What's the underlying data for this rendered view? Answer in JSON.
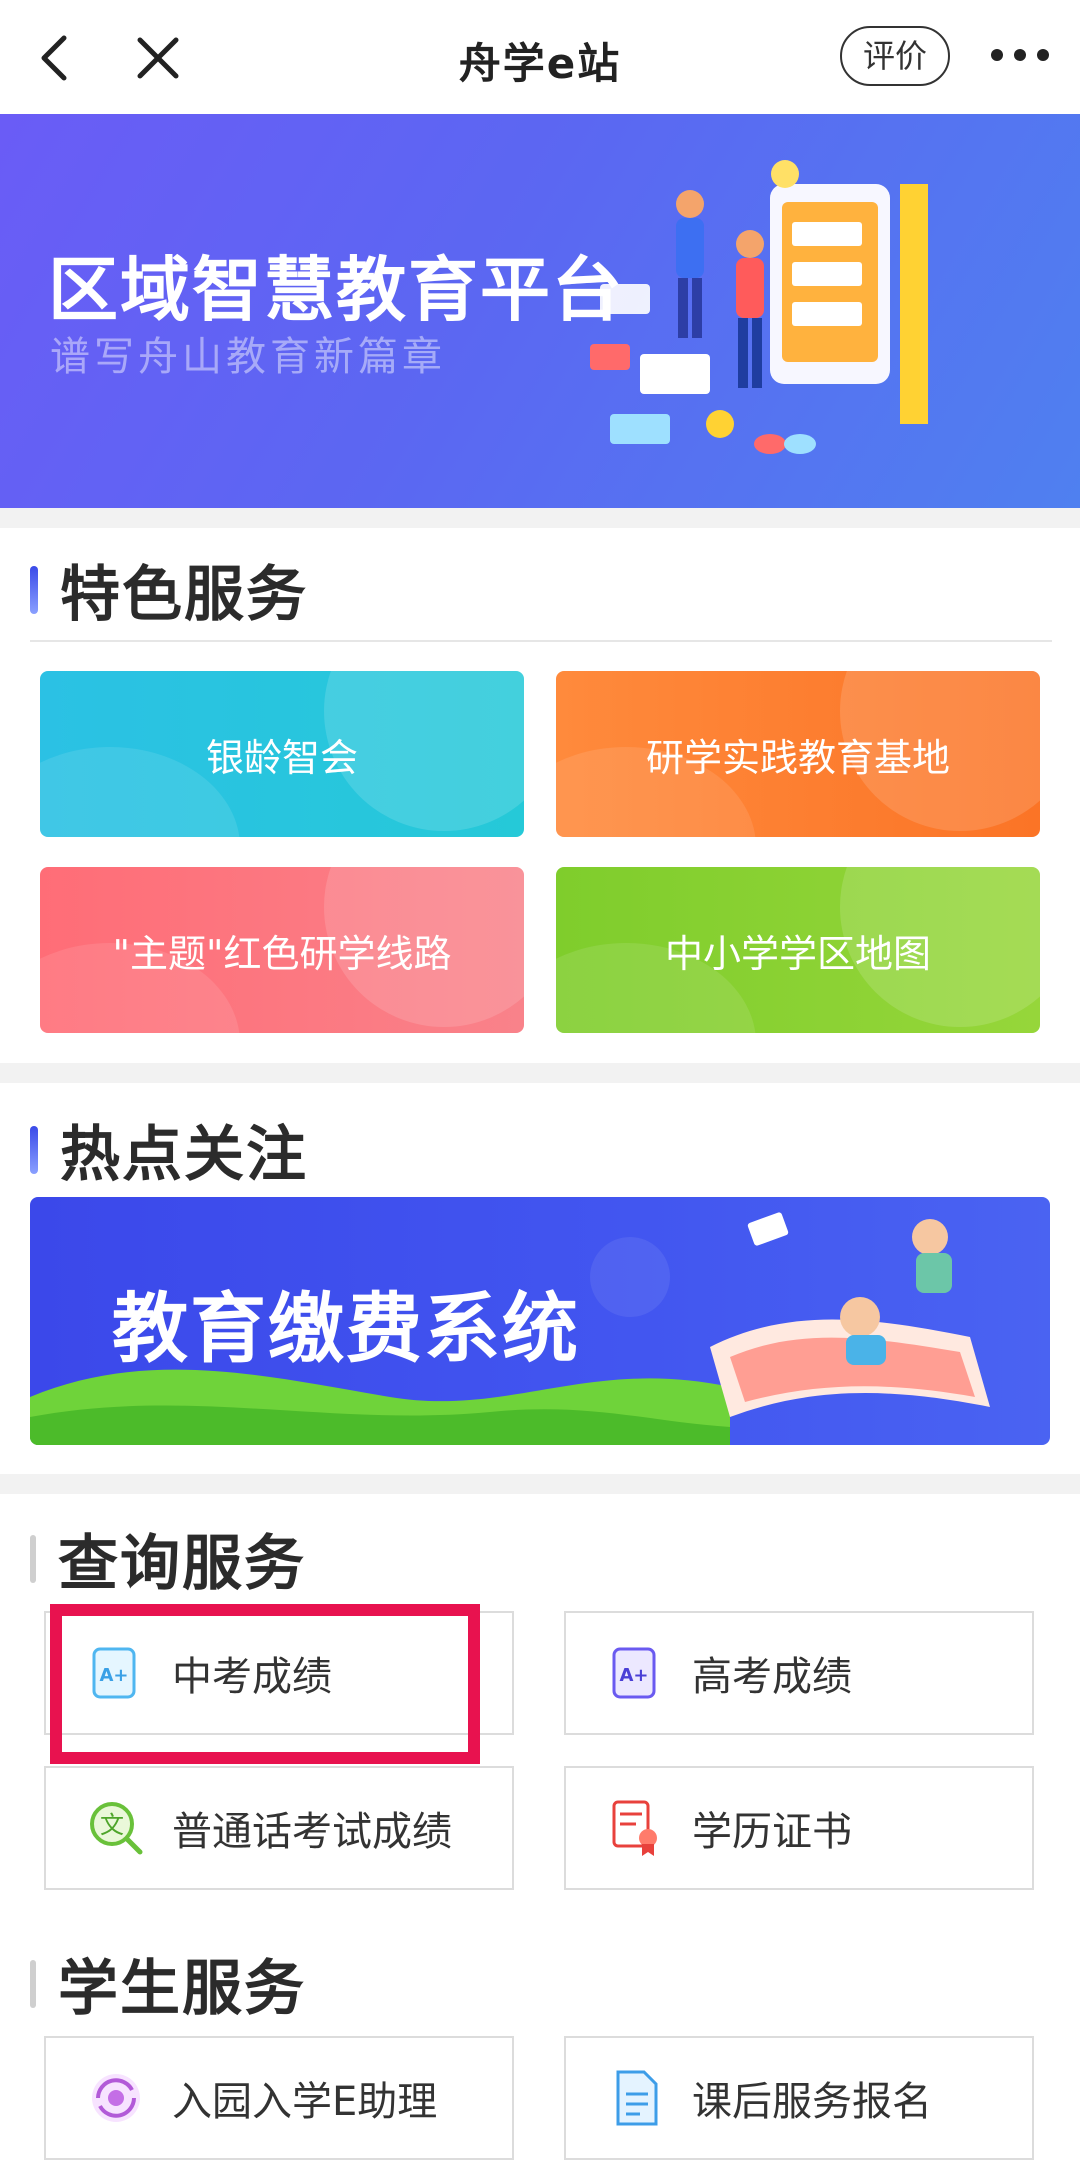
{
  "header": {
    "title": "舟学e站",
    "rate_label": "评价",
    "back_icon": "chevron-left-icon",
    "close_icon": "close-icon",
    "more_icon": "more-dots-icon"
  },
  "banner": {
    "title": "区域智慧教育平台",
    "subtitle": "谱写舟山教育新篇章"
  },
  "featured": {
    "title": "特色服务",
    "tiles": [
      {
        "label": "银龄智会",
        "color": "#29c6e0"
      },
      {
        "label": "研学实践教育基地",
        "color": "#fb7d32"
      },
      {
        "label": "\"主题\"红色研学线路",
        "color": "#f86f78"
      },
      {
        "label": "中小学学区地图",
        "color": "#86cf2e"
      }
    ]
  },
  "hot": {
    "title": "热点关注",
    "banner_title": "教育缴费系统"
  },
  "query": {
    "title": "查询服务",
    "items": [
      {
        "label": "中考成绩",
        "icon": "grade-a-plus-icon"
      },
      {
        "label": "高考成绩",
        "icon": "grade-a-plus-icon"
      },
      {
        "label": "普通话考试成绩",
        "icon": "mandarin-text-search-icon"
      },
      {
        "label": "学历证书",
        "icon": "certificate-icon"
      }
    ]
  },
  "student": {
    "title": "学生服务",
    "items": [
      {
        "label": "入园入学E助理",
        "icon": "assistant-icon"
      },
      {
        "label": "课后服务报名",
        "icon": "document-icon"
      }
    ]
  },
  "colors": {
    "highlight": "#e8124f",
    "accent": "#3b48ea"
  }
}
